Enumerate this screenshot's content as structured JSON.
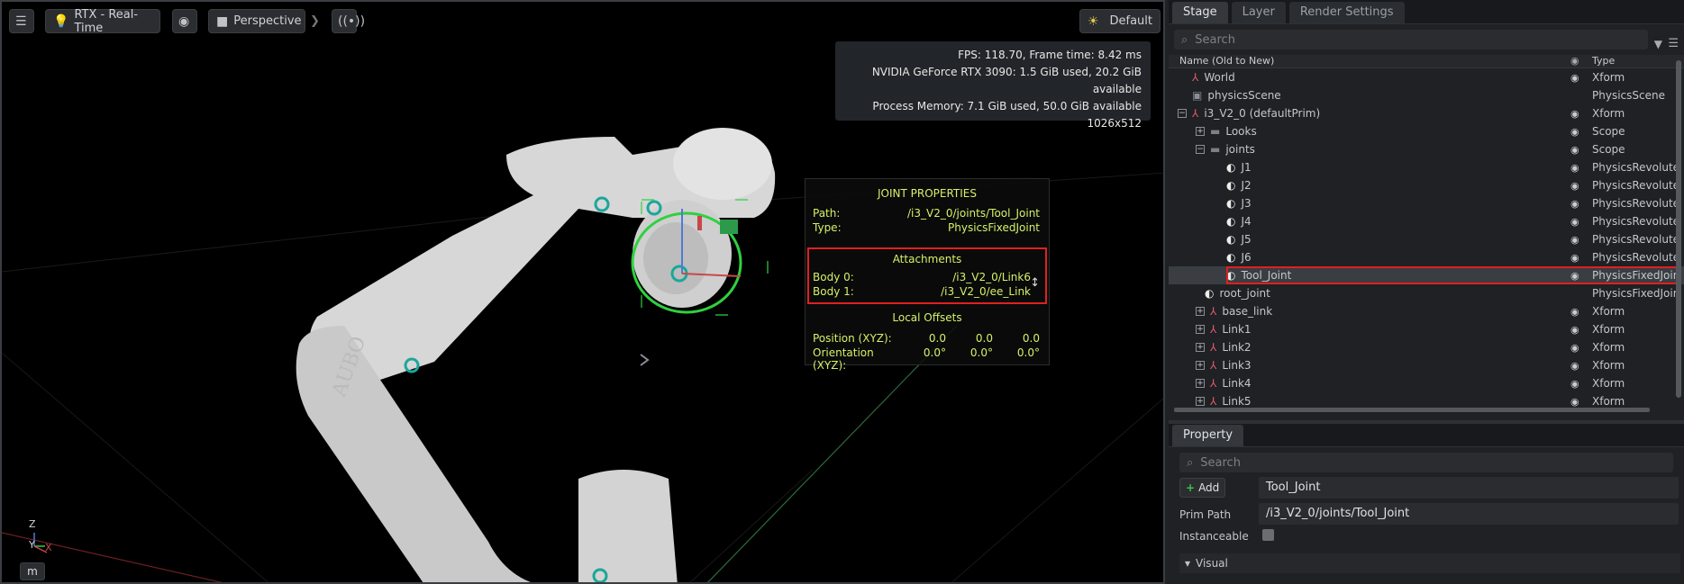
{
  "toolbar": {
    "settings_icon": "sliders-icon",
    "renderer_label": "RTX - Real-Time",
    "camera_label": "Perspective",
    "lighting_label": "Default"
  },
  "stats": {
    "fps_line": "FPS: 118.70, Frame time: 8.42 ms",
    "gpu_line": "NVIDIA GeForce RTX 3090: 1.5 GiB used, 20.2 GiB available",
    "mem_line": "Process Memory: 7.1 GiB used, 50.0 GiB available",
    "resolution": "1026x512"
  },
  "joint_props": {
    "title": "JOINT PROPERTIES",
    "path_label": "Path:",
    "path_value": "/i3_V2_0/joints/Tool_Joint",
    "type_label": "Type:",
    "type_value": "PhysicsFixedJoint",
    "attachments_title": "Attachments",
    "body0_label": "Body 0:",
    "body0_value": "/i3_V2_0/Link6",
    "body1_label": "Body 1:",
    "body1_value": "/i3_V2_0/ee_Link",
    "offsets_title": "Local Offsets",
    "position_label": "Position (XYZ):",
    "position_values": [
      "0.0",
      "0.0",
      "0.0"
    ],
    "orientation_label": "Orientation (XYZ):",
    "orientation_values": [
      "0.0°",
      "0.0°",
      "0.0°"
    ]
  },
  "robot_text": "AUBO",
  "axis": {
    "z": "Z",
    "y": "Y",
    "x": "X"
  },
  "m_button": "m",
  "stage": {
    "tabs": [
      "Stage",
      "Layer",
      "Render Settings"
    ],
    "search_placeholder": "Search",
    "col_name": "Name (Old to New)",
    "col_type": "Type",
    "rows": [
      {
        "name": "World",
        "type": "Xform",
        "icon": "xform-icon",
        "eye": true
      },
      {
        "name": "physicsScene",
        "type": "PhysicsScene",
        "icon": "cube-icon",
        "eye": false
      },
      {
        "name": "i3_V2_0 (defaultPrim)",
        "type": "Xform",
        "icon": "xform-icon",
        "eye": true
      },
      {
        "name": "Looks",
        "type": "Scope",
        "icon": "folder-icon",
        "eye": true
      },
      {
        "name": "joints",
        "type": "Scope",
        "icon": "folder-icon",
        "eye": true
      },
      {
        "name": "J1",
        "type": "PhysicsRevolute",
        "icon": "joint-icon",
        "eye": true
      },
      {
        "name": "J2",
        "type": "PhysicsRevolute",
        "icon": "joint-icon",
        "eye": true
      },
      {
        "name": "J3",
        "type": "PhysicsRevolute",
        "icon": "joint-icon",
        "eye": true
      },
      {
        "name": "J4",
        "type": "PhysicsRevolute",
        "icon": "joint-icon",
        "eye": true
      },
      {
        "name": "J5",
        "type": "PhysicsRevolute",
        "icon": "joint-icon",
        "eye": true
      },
      {
        "name": "J6",
        "type": "PhysicsRevolute",
        "icon": "joint-icon",
        "eye": true
      },
      {
        "name": "Tool_Joint",
        "type": "PhysicsFixedJoin",
        "icon": "joint-icon",
        "eye": true
      },
      {
        "name": "root_joint",
        "type": "PhysicsFixedJoin",
        "icon": "joint-icon",
        "eye": false
      },
      {
        "name": "base_link",
        "type": "Xform",
        "icon": "xform-icon",
        "eye": true
      },
      {
        "name": "Link1",
        "type": "Xform",
        "icon": "xform-icon",
        "eye": true
      },
      {
        "name": "Link2",
        "type": "Xform",
        "icon": "xform-icon",
        "eye": true
      },
      {
        "name": "Link3",
        "type": "Xform",
        "icon": "xform-icon",
        "eye": true
      },
      {
        "name": "Link4",
        "type": "Xform",
        "icon": "xform-icon",
        "eye": true
      },
      {
        "name": "Link5",
        "type": "Xform",
        "icon": "xform-icon",
        "eye": true
      }
    ]
  },
  "property": {
    "tab": "Property",
    "search_placeholder": "Search",
    "add_label": "Add",
    "name_value": "Tool_Joint",
    "prim_path_label": "Prim Path",
    "prim_path_value": "/i3_V2_0/joints/Tool_Joint",
    "instanceable_label": "Instanceable",
    "instanceable_checked": false,
    "visual_section": "Visual"
  },
  "colors": {
    "accent_green": "#d7f06a",
    "selection_red": "#e02020",
    "gizmo_green": "#2fd13f"
  }
}
